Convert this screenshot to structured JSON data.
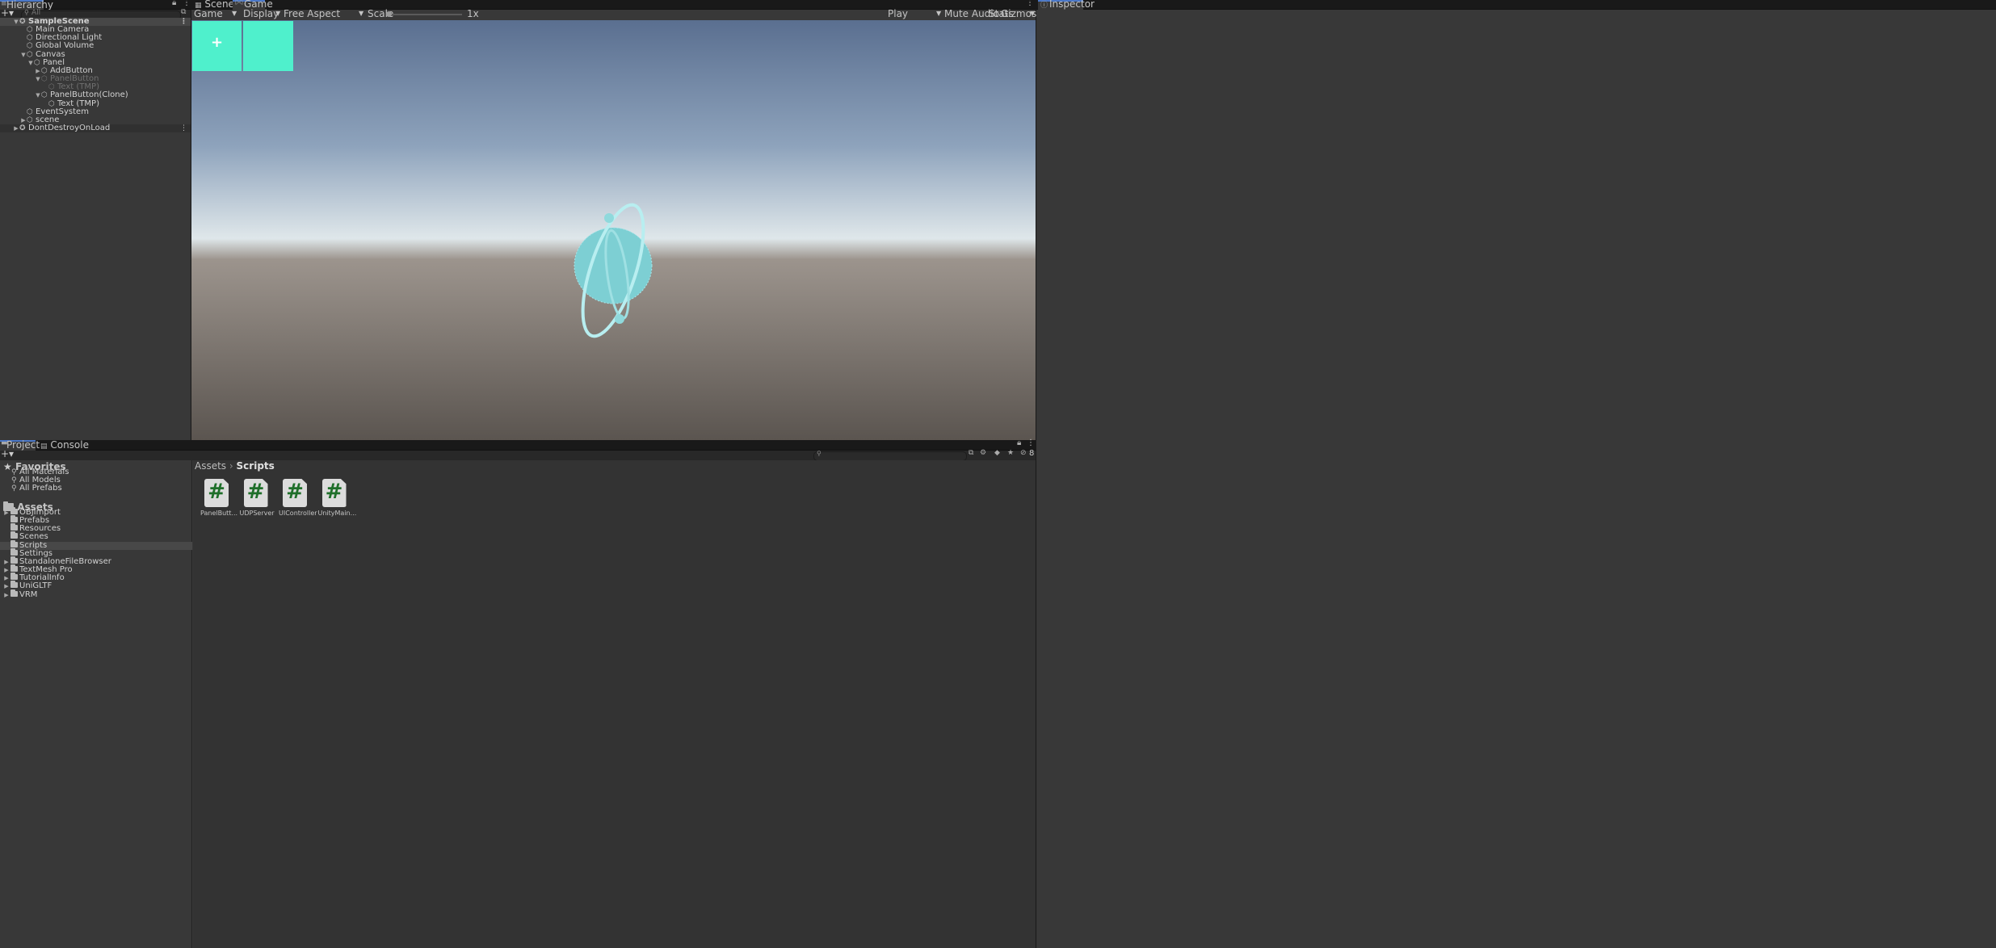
{
  "hierarchy": {
    "tab_label": "Hierarchy",
    "search_placeholder": "All",
    "rows": [
      {
        "label": "SampleScene",
        "depth": 0,
        "arrow": "▼",
        "kind": "scene"
      },
      {
        "label": "Main Camera",
        "depth": 1,
        "arrow": "",
        "kind": "object"
      },
      {
        "label": "Directional Light",
        "depth": 1,
        "arrow": "",
        "kind": "object"
      },
      {
        "label": "Global Volume",
        "depth": 1,
        "arrow": "",
        "kind": "object"
      },
      {
        "label": "Canvas",
        "depth": 1,
        "arrow": "▼",
        "kind": "object"
      },
      {
        "label": "Panel",
        "depth": 2,
        "arrow": "▼",
        "kind": "object"
      },
      {
        "label": "AddButton",
        "depth": 3,
        "arrow": "▶",
        "kind": "object"
      },
      {
        "label": "PanelButton",
        "depth": 3,
        "arrow": "▼",
        "kind": "inactive"
      },
      {
        "label": "Text (TMP)",
        "depth": 4,
        "arrow": "",
        "kind": "inactive"
      },
      {
        "label": "PanelButton(Clone)",
        "depth": 3,
        "arrow": "▼",
        "kind": "object"
      },
      {
        "label": "Text (TMP)",
        "depth": 4,
        "arrow": "",
        "kind": "object"
      },
      {
        "label": "EventSystem",
        "depth": 1,
        "arrow": "",
        "kind": "object"
      },
      {
        "label": "scene",
        "depth": 1,
        "arrow": "▶",
        "kind": "object"
      },
      {
        "label": "DontDestroyOnLoad",
        "depth": 0,
        "arrow": "▶",
        "kind": "scene-dim"
      }
    ]
  },
  "view": {
    "tabs": [
      {
        "label": "Scene",
        "icon": "grid-icon"
      },
      {
        "label": "Game",
        "icon": "gamepad-icon"
      }
    ],
    "active_tab": "Game",
    "toolbar": {
      "mode": "Game",
      "display": "Display 1",
      "aspect": "Free Aspect",
      "scale_label": "Scale",
      "scale_value": "1x",
      "play_mode": "Play Focused",
      "mute_audio": "Mute Audio",
      "stats": "Stats",
      "gizmos": "Gizmos"
    },
    "game": {
      "add_button_symbol": "+",
      "button_color": "#4ff0cc",
      "sky_top": "#5a6f90",
      "horizon": "#dfe7ea",
      "ground": "#5b5550"
    }
  },
  "inspector": {
    "tab_label": "Inspector"
  },
  "project": {
    "tabs": [
      {
        "label": "Project",
        "icon": "folder-icon"
      },
      {
        "label": "Console",
        "icon": "console-icon"
      }
    ],
    "active_tab": "Project",
    "hidden_packages_count": "8",
    "favorites": {
      "label": "Favorites",
      "items": [
        "All Materials",
        "All Models",
        "All Prefabs"
      ]
    },
    "assets_root": "Assets",
    "folders": [
      {
        "label": "OBJImport",
        "arrow": "▶",
        "selected": false
      },
      {
        "label": "Prefabs",
        "arrow": "",
        "selected": false
      },
      {
        "label": "Resources",
        "arrow": "",
        "selected": false
      },
      {
        "label": "Scenes",
        "arrow": "",
        "selected": false
      },
      {
        "label": "Scripts",
        "arrow": "",
        "selected": true
      },
      {
        "label": "Settings",
        "arrow": "",
        "selected": false
      },
      {
        "label": "StandaloneFileBrowser",
        "arrow": "▶",
        "selected": false
      },
      {
        "label": "TextMesh Pro",
        "arrow": "▶",
        "selected": false
      },
      {
        "label": "TutorialInfo",
        "arrow": "▶",
        "selected": false
      },
      {
        "label": "UniGLTF",
        "arrow": "▶",
        "selected": false
      },
      {
        "label": "VRM",
        "arrow": "▶",
        "selected": false
      }
    ],
    "breadcrumb": [
      "Assets",
      "Scripts"
    ],
    "breadcrumb_separator": "›",
    "files": [
      {
        "name": "PanelButt...",
        "glyph": "#"
      },
      {
        "name": "UDPServer",
        "glyph": "#"
      },
      {
        "name": "UIController",
        "glyph": "#"
      },
      {
        "name": "UnityMain...",
        "glyph": "#"
      }
    ]
  }
}
